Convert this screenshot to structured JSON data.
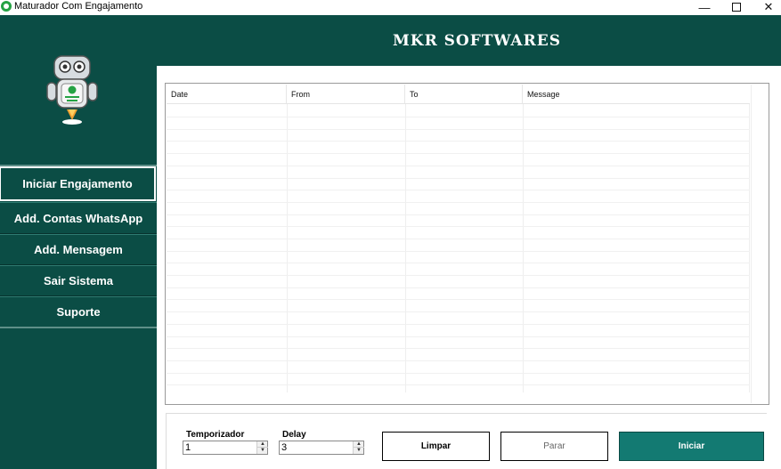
{
  "window": {
    "title": "Maturador Com Engajamento",
    "min_glyph": "—",
    "close_glyph": "✕"
  },
  "header": {
    "brand": "MKR SOFTWARES"
  },
  "sidebar": {
    "items": [
      {
        "label": "Iniciar Engajamento"
      },
      {
        "label": "Add. Contas WhatsApp"
      },
      {
        "label": "Add. Mensagem"
      },
      {
        "label": "Sair Sistema"
      },
      {
        "label": "Suporte"
      }
    ]
  },
  "table": {
    "columns": [
      "Date",
      "From",
      "To",
      "Message"
    ],
    "rows": []
  },
  "controls": {
    "temporizador_label": "Temporizador",
    "temporizador_value": "1",
    "delay_label": "Delay",
    "delay_value": "3",
    "spin_up": "▲",
    "spin_down": "▼"
  },
  "buttons": {
    "limpar": "Limpar",
    "parar": "Parar",
    "iniciar": "Iniciar"
  },
  "colors": {
    "sidebar": "#0b4d45",
    "accent": "#137a72"
  }
}
